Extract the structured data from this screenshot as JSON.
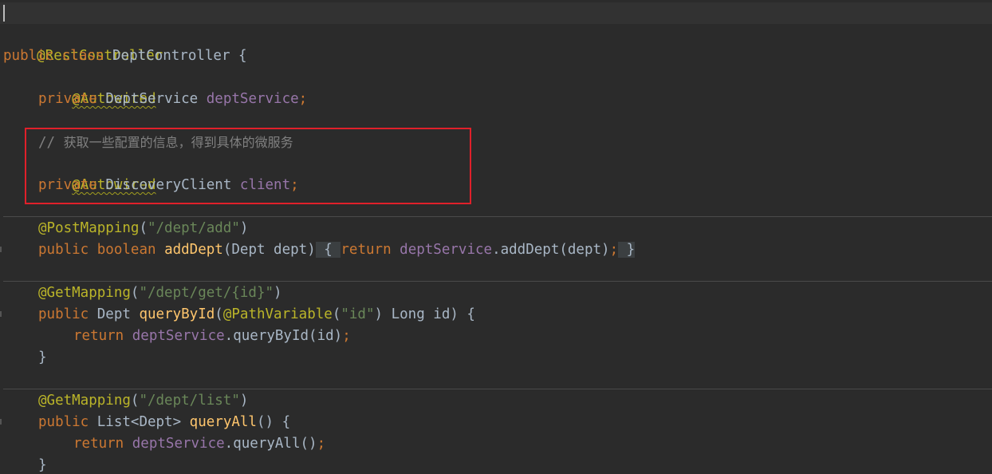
{
  "code": {
    "class_annotation": "@RestController",
    "class_decl": {
      "public": "public",
      "class": "class",
      "name": "DeptController",
      "open": " {"
    },
    "field1": {
      "annotation": "@Autowired",
      "modifier": "private",
      "type": "DeptService",
      "name": "deptService",
      "semi": ";"
    },
    "field2": {
      "comment_slash": "//",
      "comment_text": "获取一些配置的信息，得到具体的微服务",
      "annotation": "@Autowired",
      "modifier": "private",
      "type": "DiscoveryClient",
      "name": "client",
      "semi": ";"
    },
    "method_add": {
      "annotation": "@PostMapping",
      "path": "\"/dept/add\"",
      "public": "public",
      "return_type": "boolean",
      "name": "addDept",
      "params": "(Dept dept)",
      "open_brace": "{",
      "return": "return",
      "receiver": "deptService",
      "call": ".addDept(dept)",
      "semi": ";",
      "close_brace": "}"
    },
    "method_get": {
      "annotation": "@GetMapping",
      "path": "\"/dept/get/{id}\"",
      "public": "public",
      "return_type": "Dept",
      "name": "queryById",
      "param_annotation": "@PathVariable",
      "param_key": "\"id\"",
      "param_rest": " Long id) {",
      "return": "return",
      "receiver": "deptService",
      "call": ".queryById(id)",
      "semi": ";",
      "close": "}"
    },
    "method_list": {
      "annotation": "@GetMapping",
      "path": "\"/dept/list\"",
      "public": "public",
      "return_type": "List<Dept>",
      "name": "queryAll",
      "params": "() {",
      "return": "return",
      "receiver": "deptService",
      "call": ".queryAll()",
      "semi": ";",
      "close": "}"
    }
  },
  "colors": {
    "background": "#2b2b2b",
    "keyword": "#cc7832",
    "annotation": "#bbb529",
    "field": "#9876aa",
    "string": "#6a8759",
    "method": "#ffc66d",
    "comment": "#808080",
    "highlight_box": "#e0202a"
  }
}
